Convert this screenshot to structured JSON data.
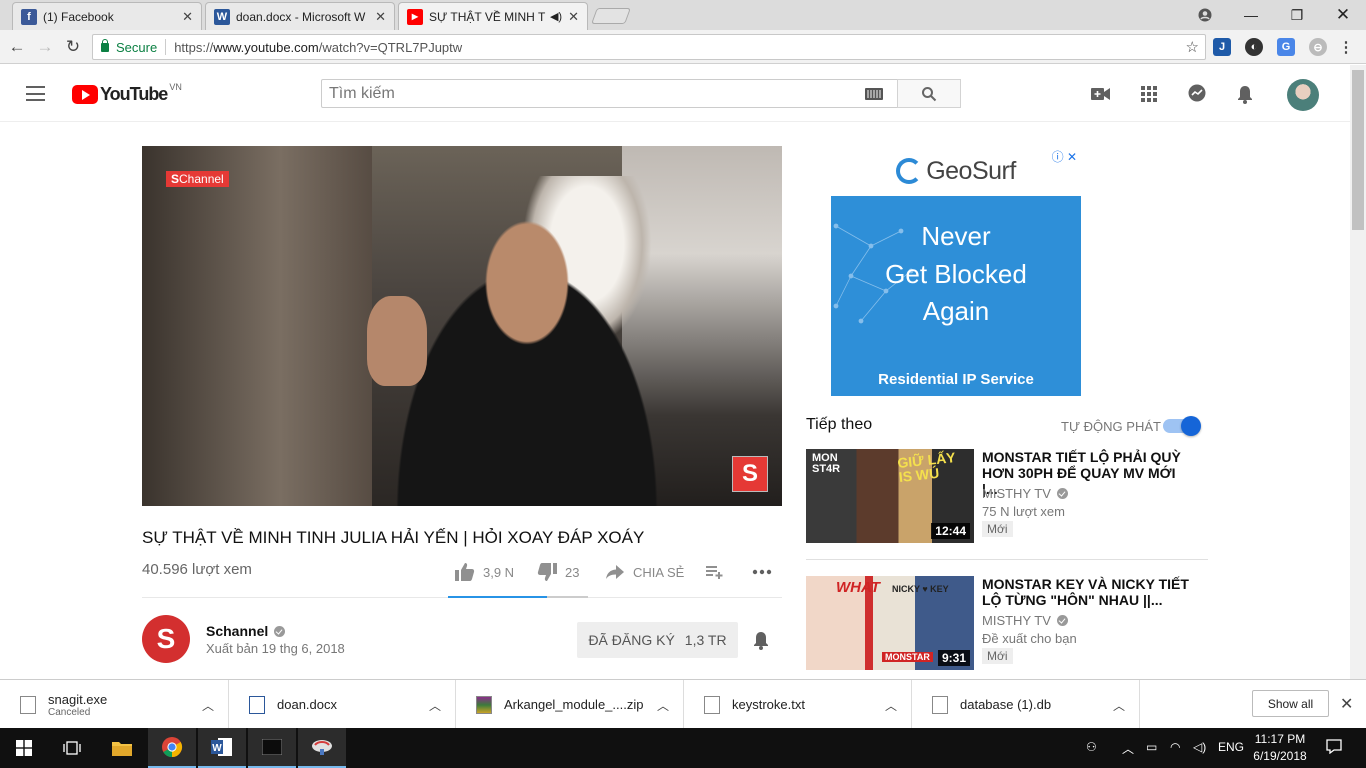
{
  "browser": {
    "tabs": [
      {
        "title": "(1) Facebook",
        "icon": "facebook-icon",
        "color": "#3b5998"
      },
      {
        "title": "doan.docx - Microsoft W",
        "icon": "word-icon",
        "color": "#2b579a"
      },
      {
        "title": "SỰ THẬT VỀ MINH TI",
        "icon": "youtube-icon",
        "color": "#ff0000"
      }
    ],
    "secure_label": "Secure",
    "url_prefix": "https://",
    "url_host": "www.youtube.com",
    "url_path": "/watch?v=QTRL7PJuptw"
  },
  "youtube": {
    "logo_text": "YouTube",
    "country": "VN",
    "search_placeholder": "Tìm kiếm"
  },
  "video": {
    "overlay_badge": "Channel",
    "title": "SỰ THẬT VỀ MINH TINH JULIA HẢI YẾN | HỎI XOAY ĐÁP XOÁY",
    "views": "40.596 lượt xem",
    "likes": "3,9 N",
    "dislikes": "23",
    "share_label": "CHIA SẺ",
    "like_ratio": 0.71
  },
  "channel": {
    "name": "Schannel",
    "published": "Xuất bản 19 thg 6, 2018",
    "subscribe_label": "ĐÃ ĐĂNG KÝ",
    "subscriber_count": "1,3 TR"
  },
  "ad": {
    "brand": "GeoSurf",
    "line1": "Never",
    "line2": "Get Blocked",
    "line3": "Again",
    "footer": "Residential IP Service",
    "controls": "ⓘ ✕"
  },
  "upnext": {
    "label": "Tiếp theo",
    "autoplay_label": "TỰ ĐỘNG PHÁT",
    "autoplay_on": true,
    "items": [
      {
        "title": "MONSTAR TIẾT LỘ PHẢI QUỲ HƠN 30PH ĐỂ QUAY MV MỚI |...",
        "channel": "MISTHY TV",
        "meta": "75 N lượt xem",
        "badge": "Mới",
        "duration": "12:44"
      },
      {
        "title": "MONSTAR KEY VÀ NICKY TIẾT LỘ TỪNG \"HÔN\" NHAU ||...",
        "channel": "MISTHY TV",
        "meta": "Đề xuất cho bạn",
        "badge": "Mới",
        "duration": "9:31"
      }
    ]
  },
  "downloads": {
    "items": [
      {
        "name": "snagit.exe",
        "status": "Canceled"
      },
      {
        "name": "doan.docx",
        "status": ""
      },
      {
        "name": "Arkangel_module_....zip",
        "status": ""
      },
      {
        "name": "keystroke.txt",
        "status": ""
      },
      {
        "name": "database (1).db",
        "status": ""
      }
    ],
    "show_all": "Show all"
  },
  "taskbar": {
    "lang": "ENG",
    "time": "11:17 PM",
    "date": "6/19/2018"
  }
}
